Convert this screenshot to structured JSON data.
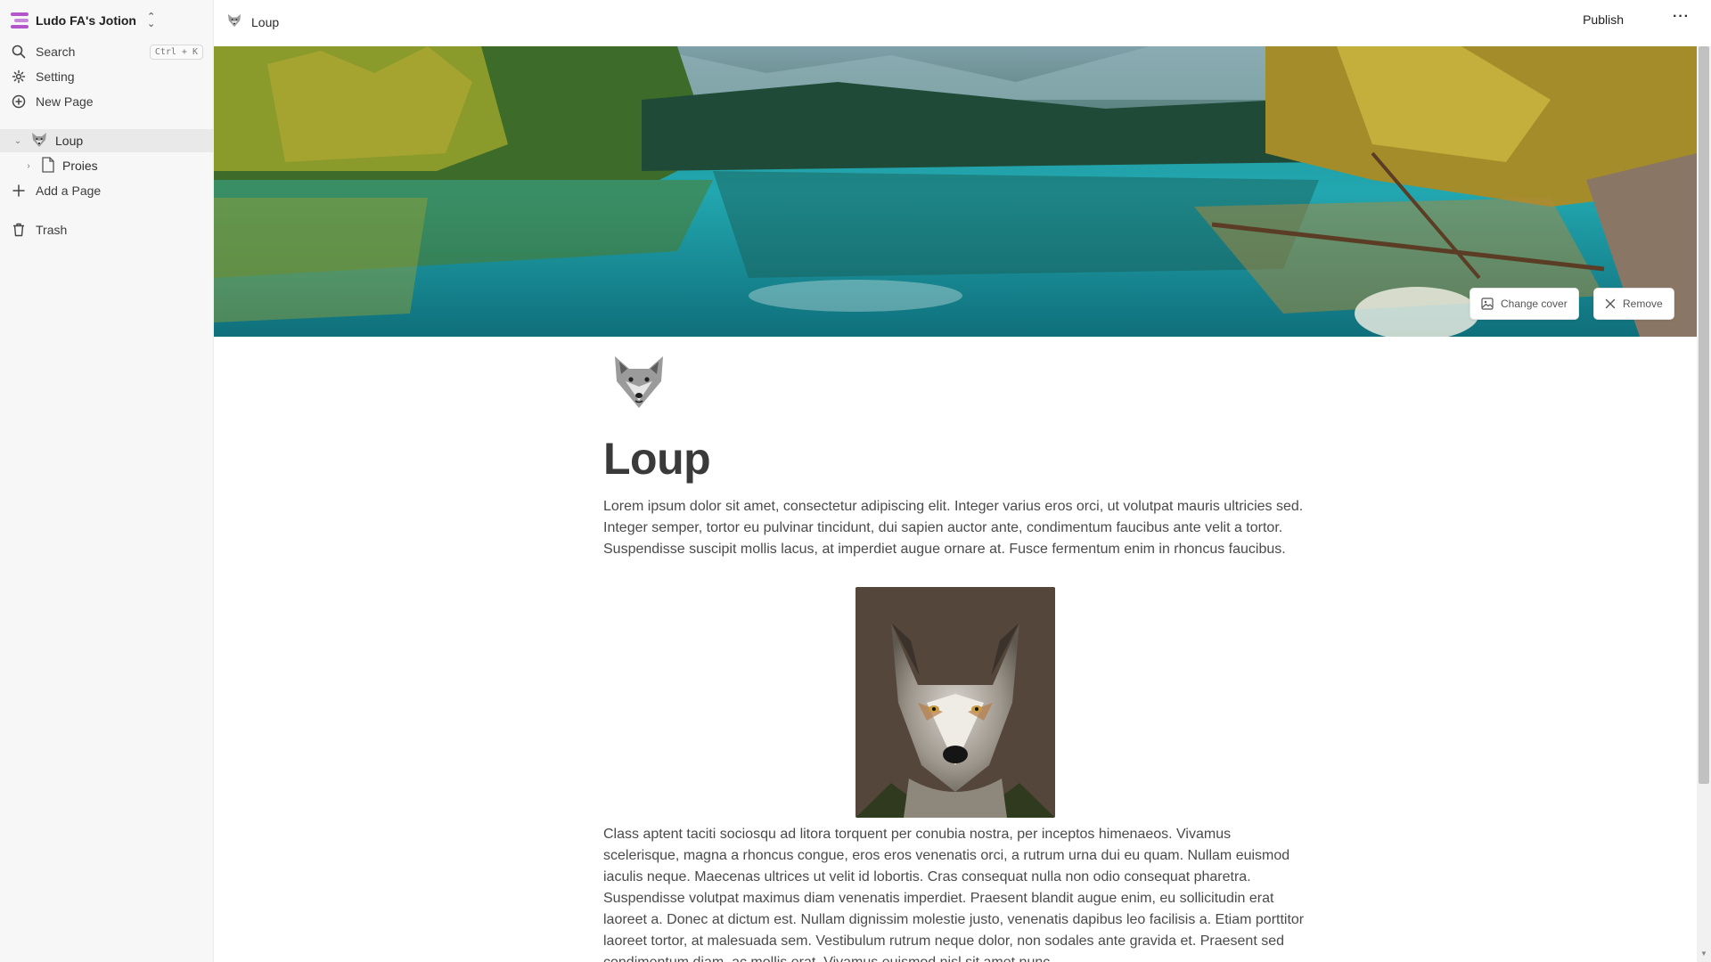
{
  "sidebar": {
    "workspace_name": "Ludo FA's Jotion",
    "search_label": "Search",
    "search_shortcut": "Ctrl + K",
    "setting_label": "Setting",
    "new_page_label": "New Page",
    "tree": [
      {
        "label": "Loup",
        "icon": "wolf-emoji",
        "expanded": true
      },
      {
        "label": "Proies",
        "icon": "file-icon",
        "expanded": false
      }
    ],
    "add_page_label": "Add a Page",
    "trash_label": "Trash"
  },
  "topbar": {
    "breadcrumb": "Loup",
    "publish_label": "Publish",
    "more_label": "···"
  },
  "cover": {
    "change_cover_label": "Change cover",
    "remove_label": "Remove"
  },
  "page": {
    "icon": "wolf-emoji",
    "title": "Loup",
    "paragraph_1": "Lorem ipsum dolor sit amet, consectetur adipiscing elit. Integer varius eros orci, ut volutpat mauris ultricies sed. Integer semper, tortor eu pulvinar tincidunt, dui sapien auctor ante, condimentum faucibus ante velit a tortor. Suspendisse suscipit mollis lacus, at imperdiet augue ornare at. Fusce fermentum enim in rhoncus faucibus.",
    "paragraph_2": "Class aptent taciti sociosqu ad litora torquent per conubia nostra, per inceptos himenaeos. Vivamus scelerisque, magna a rhoncus congue, eros eros venenatis orci, a rutrum urna dui eu quam. Nullam euismod iaculis neque. Maecenas ultrices ut velit id lobortis. Cras consequat nulla non odio consequat pharetra. Suspendisse volutpat maximus diam venenatis imperdiet. Praesent blandit augue enim, eu sollicitudin erat laoreet a. Donec at dictum est. Nullam dignissim molestie justo, venenatis dapibus leo facilisis a. Etiam porttitor laoreet tortor, at malesuada sem. Vestibulum rutrum neque dolor, non sodales ante gravida et. Praesent sed condimentum diam, ac mollis erat. Vivamus euismod nisl sit amet nunc."
  },
  "colors": {
    "sidebar_bg": "#f7f7f7",
    "active_item_bg": "#e9e9e9",
    "brand_purple": "#b256c9"
  }
}
